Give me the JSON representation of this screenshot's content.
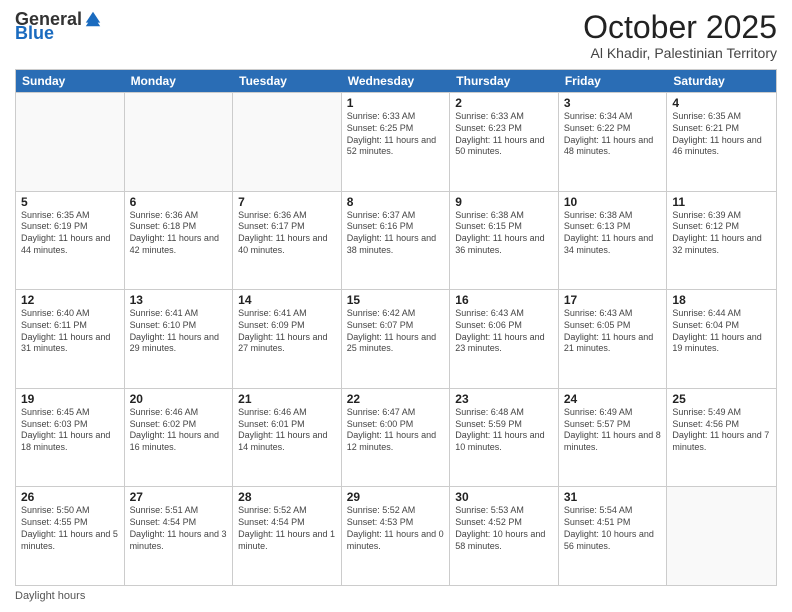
{
  "header": {
    "logo_general": "General",
    "logo_blue": "Blue",
    "month": "October 2025",
    "location": "Al Khadir, Palestinian Territory"
  },
  "days_of_week": [
    "Sunday",
    "Monday",
    "Tuesday",
    "Wednesday",
    "Thursday",
    "Friday",
    "Saturday"
  ],
  "weeks": [
    [
      {
        "day": "",
        "info": ""
      },
      {
        "day": "",
        "info": ""
      },
      {
        "day": "",
        "info": ""
      },
      {
        "day": "1",
        "info": "Sunrise: 6:33 AM\nSunset: 6:25 PM\nDaylight: 11 hours\nand 52 minutes."
      },
      {
        "day": "2",
        "info": "Sunrise: 6:33 AM\nSunset: 6:23 PM\nDaylight: 11 hours\nand 50 minutes."
      },
      {
        "day": "3",
        "info": "Sunrise: 6:34 AM\nSunset: 6:22 PM\nDaylight: 11 hours\nand 48 minutes."
      },
      {
        "day": "4",
        "info": "Sunrise: 6:35 AM\nSunset: 6:21 PM\nDaylight: 11 hours\nand 46 minutes."
      }
    ],
    [
      {
        "day": "5",
        "info": "Sunrise: 6:35 AM\nSunset: 6:19 PM\nDaylight: 11 hours\nand 44 minutes."
      },
      {
        "day": "6",
        "info": "Sunrise: 6:36 AM\nSunset: 6:18 PM\nDaylight: 11 hours\nand 42 minutes."
      },
      {
        "day": "7",
        "info": "Sunrise: 6:36 AM\nSunset: 6:17 PM\nDaylight: 11 hours\nand 40 minutes."
      },
      {
        "day": "8",
        "info": "Sunrise: 6:37 AM\nSunset: 6:16 PM\nDaylight: 11 hours\nand 38 minutes."
      },
      {
        "day": "9",
        "info": "Sunrise: 6:38 AM\nSunset: 6:15 PM\nDaylight: 11 hours\nand 36 minutes."
      },
      {
        "day": "10",
        "info": "Sunrise: 6:38 AM\nSunset: 6:13 PM\nDaylight: 11 hours\nand 34 minutes."
      },
      {
        "day": "11",
        "info": "Sunrise: 6:39 AM\nSunset: 6:12 PM\nDaylight: 11 hours\nand 32 minutes."
      }
    ],
    [
      {
        "day": "12",
        "info": "Sunrise: 6:40 AM\nSunset: 6:11 PM\nDaylight: 11 hours\nand 31 minutes."
      },
      {
        "day": "13",
        "info": "Sunrise: 6:41 AM\nSunset: 6:10 PM\nDaylight: 11 hours\nand 29 minutes."
      },
      {
        "day": "14",
        "info": "Sunrise: 6:41 AM\nSunset: 6:09 PM\nDaylight: 11 hours\nand 27 minutes."
      },
      {
        "day": "15",
        "info": "Sunrise: 6:42 AM\nSunset: 6:07 PM\nDaylight: 11 hours\nand 25 minutes."
      },
      {
        "day": "16",
        "info": "Sunrise: 6:43 AM\nSunset: 6:06 PM\nDaylight: 11 hours\nand 23 minutes."
      },
      {
        "day": "17",
        "info": "Sunrise: 6:43 AM\nSunset: 6:05 PM\nDaylight: 11 hours\nand 21 minutes."
      },
      {
        "day": "18",
        "info": "Sunrise: 6:44 AM\nSunset: 6:04 PM\nDaylight: 11 hours\nand 19 minutes."
      }
    ],
    [
      {
        "day": "19",
        "info": "Sunrise: 6:45 AM\nSunset: 6:03 PM\nDaylight: 11 hours\nand 18 minutes."
      },
      {
        "day": "20",
        "info": "Sunrise: 6:46 AM\nSunset: 6:02 PM\nDaylight: 11 hours\nand 16 minutes."
      },
      {
        "day": "21",
        "info": "Sunrise: 6:46 AM\nSunset: 6:01 PM\nDaylight: 11 hours\nand 14 minutes."
      },
      {
        "day": "22",
        "info": "Sunrise: 6:47 AM\nSunset: 6:00 PM\nDaylight: 11 hours\nand 12 minutes."
      },
      {
        "day": "23",
        "info": "Sunrise: 6:48 AM\nSunset: 5:59 PM\nDaylight: 11 hours\nand 10 minutes."
      },
      {
        "day": "24",
        "info": "Sunrise: 6:49 AM\nSunset: 5:57 PM\nDaylight: 11 hours\nand 8 minutes."
      },
      {
        "day": "25",
        "info": "Sunrise: 5:49 AM\nSunset: 4:56 PM\nDaylight: 11 hours\nand 7 minutes."
      }
    ],
    [
      {
        "day": "26",
        "info": "Sunrise: 5:50 AM\nSunset: 4:55 PM\nDaylight: 11 hours\nand 5 minutes."
      },
      {
        "day": "27",
        "info": "Sunrise: 5:51 AM\nSunset: 4:54 PM\nDaylight: 11 hours\nand 3 minutes."
      },
      {
        "day": "28",
        "info": "Sunrise: 5:52 AM\nSunset: 4:54 PM\nDaylight: 11 hours\nand 1 minute."
      },
      {
        "day": "29",
        "info": "Sunrise: 5:52 AM\nSunset: 4:53 PM\nDaylight: 11 hours\nand 0 minutes."
      },
      {
        "day": "30",
        "info": "Sunrise: 5:53 AM\nSunset: 4:52 PM\nDaylight: 10 hours\nand 58 minutes."
      },
      {
        "day": "31",
        "info": "Sunrise: 5:54 AM\nSunset: 4:51 PM\nDaylight: 10 hours\nand 56 minutes."
      },
      {
        "day": "",
        "info": ""
      }
    ]
  ],
  "footer": {
    "daylight_label": "Daylight hours"
  }
}
